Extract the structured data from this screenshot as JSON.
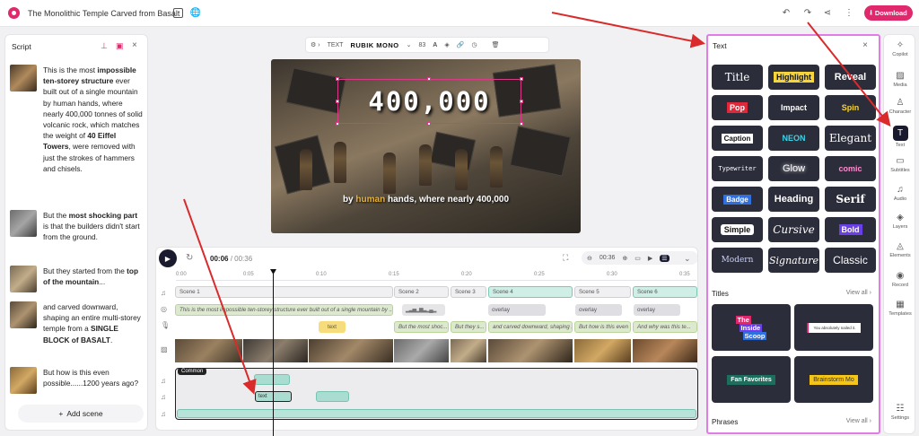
{
  "topbar": {
    "title": "The Monolithic Temple Carved from Basalt",
    "download": "Download"
  },
  "script": {
    "title": "Script",
    "entries": [
      {
        "plain_before": "This is the most ",
        "bold": "impossible ten-storey structure",
        "plain_after": " ever built out of a single mountain by human hands, where nearly 400,000 tonnes of solid volcanic rock, which matches the weight of ",
        "bold2": "40 Eiffel Towers",
        "plain_end": ", were removed with just the strokes of hammers and chisels."
      },
      {
        "plain_before": "But the ",
        "bold": "most shocking part",
        "plain_after": " is that the builders didn't start from the ground."
      },
      {
        "plain_before": "But they started from the ",
        "bold": "top of the mountain",
        "plain_after": "..."
      },
      {
        "plain_before": "and carved downward, shaping an entire multi-storey temple from a ",
        "bold": "SINGLE BLOCK of BASALT",
        "plain_after": "."
      },
      {
        "plain_before": "But how is this even possible......1200 years ago?",
        "bold": "",
        "plain_after": ""
      }
    ],
    "add_scene": "Add scene"
  },
  "toolbar": {
    "type_label": "TEXT",
    "font": "RUBIK MONO",
    "size": "83"
  },
  "canvas": {
    "big_text": "400,000",
    "subtitle_pre": "by ",
    "subtitle_hl": "human",
    "subtitle_post": " hands, where nearly 400,000"
  },
  "timeline": {
    "current": "00:06",
    "total": "00:36",
    "zoom": "00:36",
    "ticks": [
      "0:00",
      "0:05",
      "0:10",
      "0:15",
      "0:20",
      "0:25",
      "0:30",
      "0:35"
    ],
    "scenes": [
      "Scene 1",
      "Scene 2",
      "Scene 3",
      "Scene 4",
      "Scene 5",
      "Scene 6"
    ],
    "text_clips": [
      "This is the most impossible ten-storey structure ever built out of a single mountain by ...",
      "But the most shoc...",
      "But they s...",
      "and carved downward, shaping ...",
      "But how is this even ...",
      "And why was this te..."
    ],
    "overlay_label": "overlay",
    "yellow_clip": "text",
    "common_label": "Common",
    "common_text_clip": "text"
  },
  "textpanel": {
    "title": "Text",
    "styles": [
      "Title",
      "Highlight",
      "Reveal",
      "Pop",
      "Impact",
      "Spin",
      "Caption",
      "NEON",
      "Elegant",
      "Typewriter",
      "Glow",
      "comic",
      "Badge",
      "Heading",
      "Serif",
      "Simple",
      "Cursive",
      "Bold",
      "Modern",
      "Signature",
      "Classic"
    ],
    "titles_label": "Titles",
    "phrases_label": "Phrases",
    "view_all": "View all",
    "card1": [
      "The",
      "Inside",
      "Scoop"
    ],
    "card2": "You absolutely nailed it.",
    "card3": "Fan Favorites",
    "card4": "Brainstorm Mo"
  },
  "rightbar": {
    "items": [
      "Copilot",
      "Media",
      "Character",
      "Text",
      "Subtitles",
      "Audio",
      "Layers",
      "Elements",
      "Record",
      "Templates",
      "Settings"
    ]
  },
  "colors": {
    "accent": "#e0286d",
    "panel_border": "#e17be5",
    "dark": "#1a1a2e"
  }
}
